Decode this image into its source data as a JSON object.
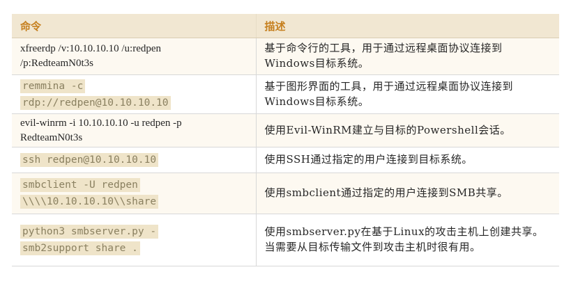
{
  "table": {
    "headers": {
      "command": "命令",
      "description": "描述"
    },
    "rows": [
      {
        "command": "xfreerdp /v:10.10.10.10 /u:redpen\n/p:RedteamN0t3s",
        "code": false,
        "description": "基于命令行的工具，用于通过远程桌面协议连接到Windows目标系统。"
      },
      {
        "command": "remmina -c\nrdp://redpen@10.10.10.10",
        "code": true,
        "description": "基于图形界面的工具，用于通过远程桌面协议连接到Windows目标系统。"
      },
      {
        "command": "evil-winrm -i 10.10.10.10 -u redpen -p\nRedteamN0t3s",
        "code": false,
        "description": "使用Evil-WinRM建立与目标的Powershell会话。"
      },
      {
        "command": "ssh redpen@10.10.10.10",
        "code": true,
        "description": "使用SSH通过指定的用户连接到目标系统。"
      },
      {
        "command": "smbclient -U redpen\n\\\\\\\\10.10.10.10\\\\share",
        "code": true,
        "description": "使用smbclient通过指定的用户连接到SMB共享。"
      },
      {
        "command": "python3 smbserver.py -\nsmb2support share .",
        "code": true,
        "description": "使用smbserver.py在基于Linux的攻击主机上创建共享。当需要从目标传输文件到攻击主机时很有用。"
      }
    ]
  },
  "colors": {
    "header_background": "#f1e7d2",
    "header_text": "#c6801f",
    "code_background": "#efe4c9",
    "code_text": "#8a8060",
    "row_alt_background": "#fdf9f1"
  }
}
